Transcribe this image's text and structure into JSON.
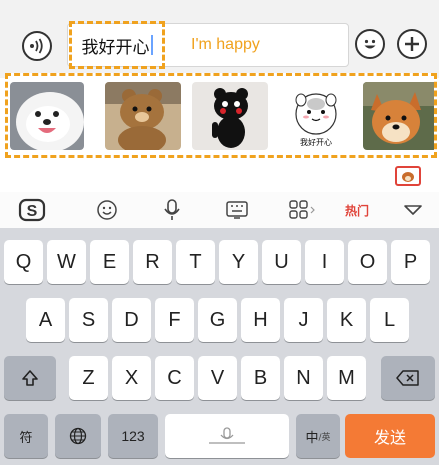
{
  "input_bar": {
    "typed_text": "我好开心",
    "translation": "I'm happy"
  },
  "sticker_strip": {
    "stickers": [
      {
        "name": "samoyed"
      },
      {
        "name": "bear"
      },
      {
        "name": "kumamon"
      },
      {
        "name": "hamster",
        "caption": "我好开心"
      },
      {
        "name": "shiba"
      }
    ]
  },
  "toolbar": {
    "brand": "S",
    "hot_label": "热门"
  },
  "keyboard": {
    "row1": [
      "Q",
      "W",
      "E",
      "R",
      "T",
      "Y",
      "U",
      "I",
      "O",
      "P"
    ],
    "row2": [
      "A",
      "S",
      "D",
      "F",
      "G",
      "H",
      "J",
      "K",
      "L"
    ],
    "row3": [
      "Z",
      "X",
      "C",
      "V",
      "B",
      "N",
      "M"
    ],
    "symbol_key": "符",
    "numbers_key": "123",
    "cn_key": "中",
    "cn_key_sub": "/英",
    "send_key": "发送"
  },
  "colors": {
    "accent_orange": "#f0a21e",
    "send_orange": "#f47a35",
    "hot_red": "#e0443a"
  }
}
